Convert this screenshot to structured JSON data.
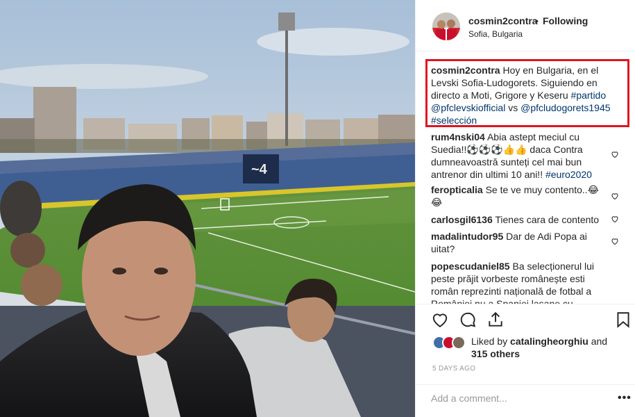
{
  "header": {
    "username": "cosmin2contra",
    "separator": "•",
    "follow_status": "Following",
    "location": "Sofia, Bulgaria"
  },
  "caption": {
    "user": "cosmin2contra",
    "lines": [
      "Hoy en Bulgaria, en el",
      "Levski Sofia-Ludogorets. Siguiendo en",
      "directo a Moti, Grigore y Keseru",
      "#partido",
      "@pfclevskiofficial",
      "vs",
      "@pfcludogorets1945",
      "#selección"
    ]
  },
  "comments": [
    {
      "user": "rum4nski04",
      "line1": "Abia astept meciul cu",
      "line2": "Suedia!!⚽⚽⚽👍👍 daca Contra",
      "line3": "dumneavoastră sunteți cel mai bun",
      "line4": "antrenor din ultimi 10 ani!!",
      "tag": "#euro2020"
    },
    {
      "user": "feropticalia",
      "line1": "Se te ve muy contento..😂",
      "line2": "😂"
    },
    {
      "user": "carlosgil6136",
      "line1": "Tienes cara de contento"
    },
    {
      "user": "madalintudor95",
      "line1": "Dar de Adi Popa ai",
      "line2": "uitat?"
    },
    {
      "user": "popescudaniel85",
      "line1": "Ba selecționerul lui",
      "line2": "peste prăjit vorbeste românește esti",
      "line3": "român reprezinti națională de fotbal a",
      "line4": "României nu a Spaniei lasane cu"
    }
  ],
  "icons": {
    "like": "heart-outline-icon",
    "comment": "speech-bubble-icon",
    "share": "share-upload-icon",
    "save": "bookmark-icon",
    "comment_like": "small-heart-icon",
    "more": "more-options-icon"
  },
  "likes": {
    "prefix": "Liked by",
    "user": "catalingheorghiu",
    "conj": "and",
    "others": "315 others"
  },
  "timestamp": "5 DAYS AGO",
  "add_comment": {
    "placeholder": "Add a comment...",
    "more": "•••"
  },
  "colors": {
    "highlight_border": "#e0141e",
    "hashtag": "#003569",
    "muted": "#999999",
    "text": "#262626"
  }
}
